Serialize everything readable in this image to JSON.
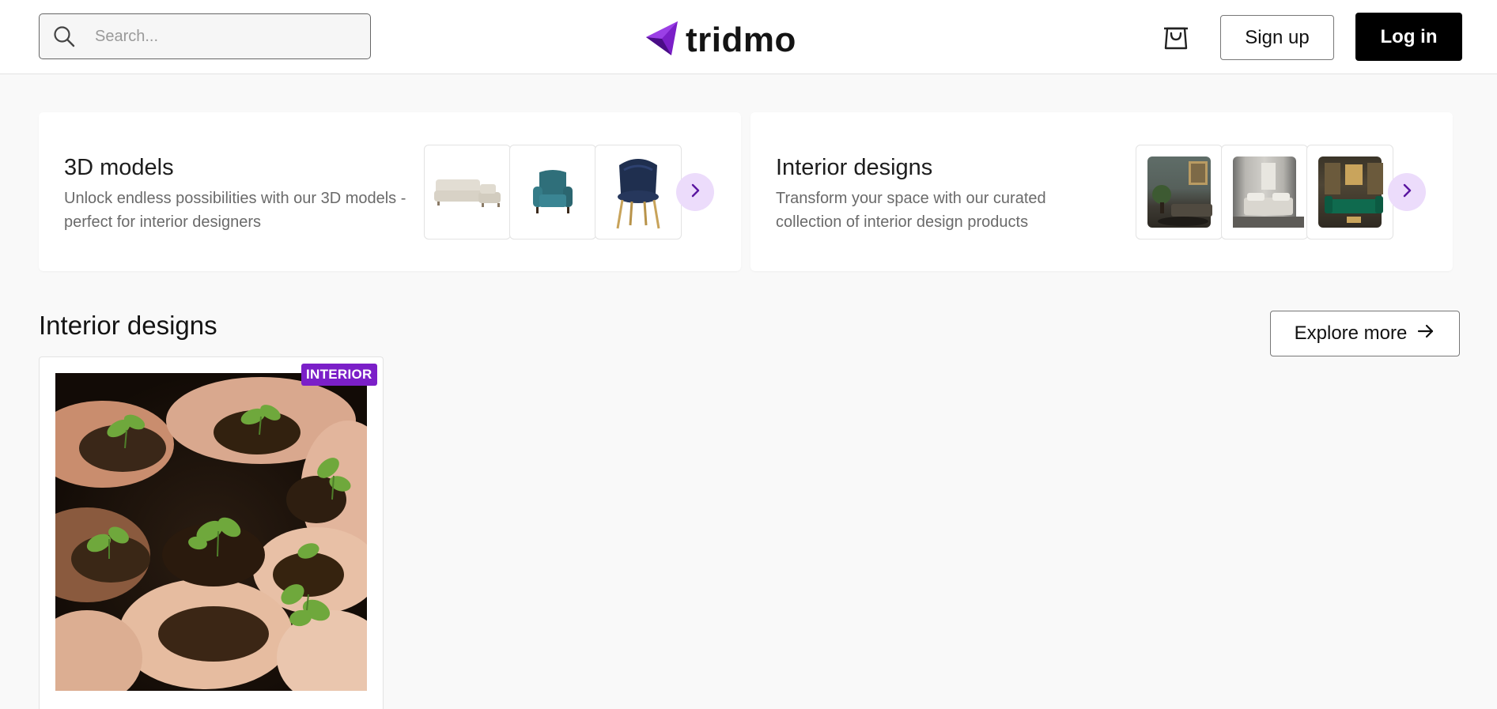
{
  "header": {
    "search": {
      "placeholder": "Search..."
    },
    "logo": {
      "text": "tridmo",
      "icon": "tridmo-logo-icon"
    },
    "cart_icon": "shopping-bag-icon",
    "signup_label": "Sign up",
    "login_label": "Log in"
  },
  "categories": [
    {
      "title": "3D models",
      "description": "Unlock endless possibilities with our 3D models - perfect for interior designers",
      "thumbnails": [
        "sofa",
        "armchair",
        "dining-chair"
      ],
      "next_icon": "chevron-right-icon"
    },
    {
      "title": "Interior designs",
      "description": "Transform your space with our curated collection of interior design products",
      "thumbnails": [
        "living-room",
        "bedroom",
        "lounge"
      ],
      "next_icon": "chevron-right-icon"
    }
  ],
  "section": {
    "title": "Interior designs",
    "explore_label": "Explore more",
    "explore_icon": "arrow-right-icon"
  },
  "products": [
    {
      "badge": "INTERIOR",
      "image": "hands-holding-seedlings"
    }
  ],
  "colors": {
    "accent": "#7b1fc8",
    "arrow_bg": "#ecdcfb",
    "login_bg": "#000000",
    "page_bg": "#f9f9f9"
  }
}
